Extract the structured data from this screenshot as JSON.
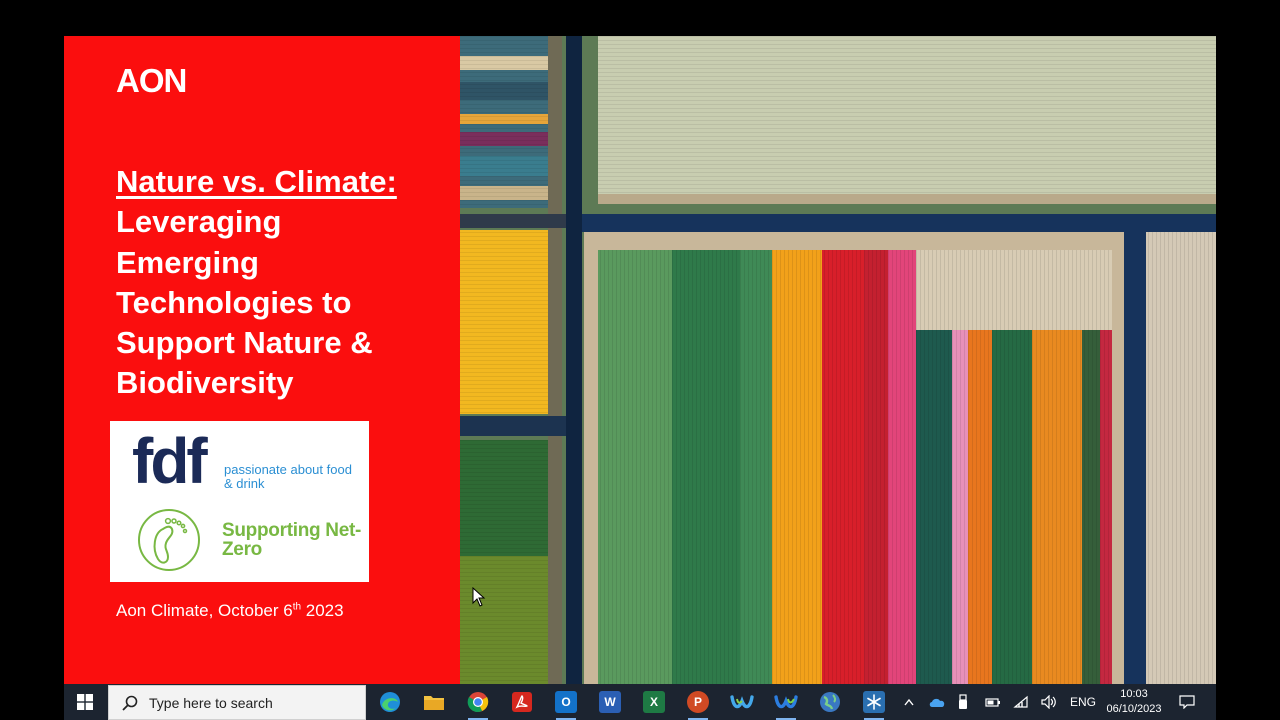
{
  "slide": {
    "brand": "AON",
    "title_underlined": "Nature vs. Climate:",
    "title_lines": [
      "Leveraging",
      "Emerging",
      "Technologies to",
      "Support Nature &",
      "Biodiversity"
    ],
    "partner_logo": {
      "wordmark": "fdf",
      "tagline": "passionate about food & drink",
      "campaign": "Supporting Net-Zero"
    },
    "footer_date_prefix": "Aon Climate, October 6",
    "footer_date_sup": "th",
    "footer_date_suffix": " 2023",
    "accent_color": "#fb0e0e"
  },
  "taskbar": {
    "search_placeholder": "Type here to search",
    "pinned_apps": [
      {
        "name": "Microsoft Edge",
        "icon": "edge-icon"
      },
      {
        "name": "File Explorer",
        "icon": "folder-icon"
      },
      {
        "name": "Google Chrome",
        "icon": "chrome-icon"
      },
      {
        "name": "Adobe Acrobat",
        "icon": "acrobat-icon"
      },
      {
        "name": "Outlook",
        "icon": "outlook-icon",
        "letter": "O"
      },
      {
        "name": "Word",
        "icon": "word-icon",
        "letter": "W"
      },
      {
        "name": "Excel",
        "icon": "excel-icon",
        "letter": "X"
      },
      {
        "name": "PowerPoint",
        "icon": "powerpoint-icon",
        "letter": "P"
      },
      {
        "name": "Webex",
        "icon": "webex-icon"
      },
      {
        "name": "Webex Meetings",
        "icon": "webex-meetings-icon"
      },
      {
        "name": "Browser",
        "icon": "globe-icon"
      },
      {
        "name": "Snowflake app",
        "icon": "snowflake-icon"
      }
    ],
    "tray": {
      "language": "ENG",
      "time": "10:03",
      "date": "06/10/2023"
    }
  }
}
